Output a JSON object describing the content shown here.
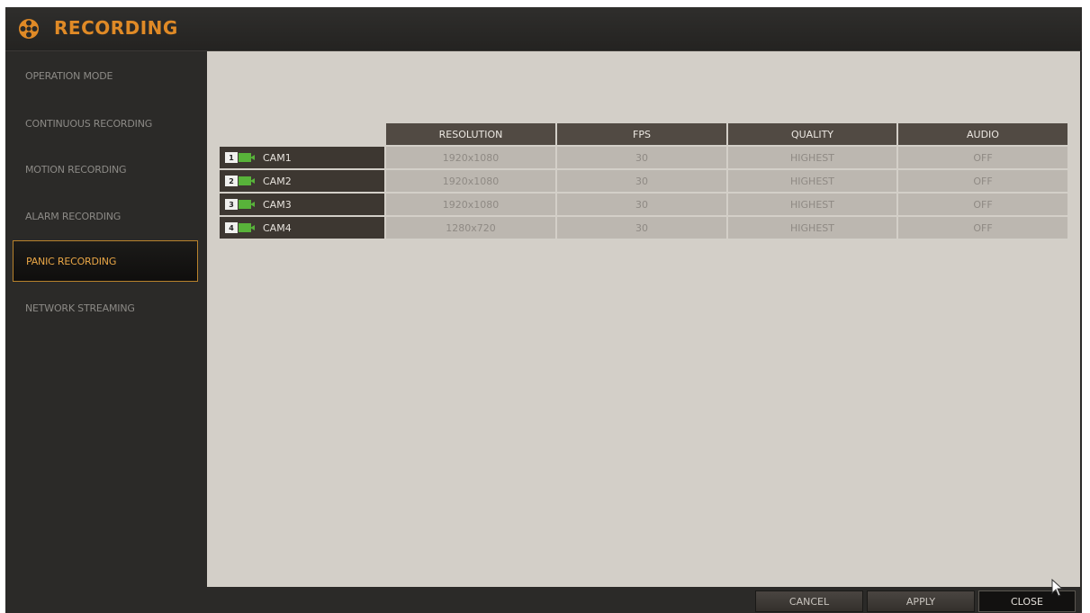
{
  "window": {
    "title": "RECORDING",
    "title_color": "#e08a26",
    "icon": "film-reel-icon"
  },
  "sidebar": {
    "active_index": 4,
    "items": [
      {
        "label": "OPERATION MODE"
      },
      {
        "label": "CONTINUOUS RECORDING"
      },
      {
        "label": "MOTION RECORDING"
      },
      {
        "label": "ALARM RECORDING"
      },
      {
        "label": "PANIC RECORDING"
      },
      {
        "label": "NETWORK STREAMING"
      }
    ]
  },
  "table": {
    "headers": [
      "RESOLUTION",
      "FPS",
      "QUALITY",
      "AUDIO"
    ],
    "rows": [
      {
        "num": "1",
        "cam": "CAM1",
        "resolution": "1920x1080",
        "fps": "30",
        "quality": "HIGHEST",
        "audio": "OFF"
      },
      {
        "num": "2",
        "cam": "CAM2",
        "resolution": "1920x1080",
        "fps": "30",
        "quality": "HIGHEST",
        "audio": "OFF"
      },
      {
        "num": "3",
        "cam": "CAM3",
        "resolution": "1920x1080",
        "fps": "30",
        "quality": "HIGHEST",
        "audio": "OFF"
      },
      {
        "num": "4",
        "cam": "CAM4",
        "resolution": "1280x720",
        "fps": "30",
        "quality": "HIGHEST",
        "audio": "OFF"
      }
    ]
  },
  "footer": {
    "cancel": "CANCEL",
    "apply": "APPLY",
    "close": "CLOSE"
  },
  "colors": {
    "accent": "#e08a26",
    "panel": "#d3cfc8",
    "camera_icon": "#58b33a"
  }
}
